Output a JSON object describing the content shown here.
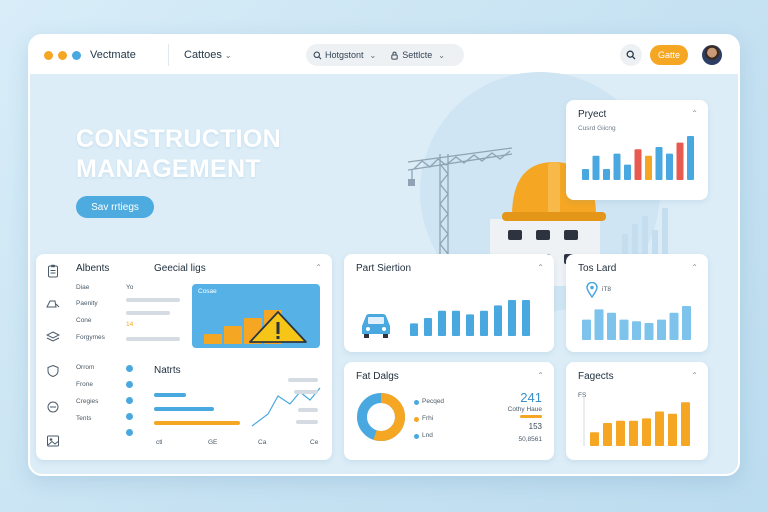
{
  "topbar": {
    "app_title": "Vectmate",
    "menu_label": "Cattoes",
    "pill_1": "Hotgstont",
    "pill_2": "Settlcte",
    "cta_label": "Gatte"
  },
  "hero": {
    "title_line1": "CONSTRUCTION",
    "title_line2": "MANAGEMENT",
    "button_label": "Sav rrtiegs"
  },
  "project_card": {
    "title": "Pryect",
    "subtitle": "Cusrd Giicng",
    "bars": [
      0.25,
      0.55,
      0.25,
      0.6,
      0.35,
      0.7,
      0.55,
      0.75,
      0.6,
      0.85,
      1.0
    ],
    "bar_colors": [
      "#4aa8e0",
      "#4aa8e0",
      "#4aa8e0",
      "#4aa8e0",
      "#4aa8e0",
      "#e85a4f",
      "#f5a623",
      "#4aa8e0",
      "#4aa8e0",
      "#e85a4f",
      "#4aa8e0"
    ]
  },
  "left_card": {
    "title_a": "Albents",
    "title_b": "Geecial ligs",
    "rows": [
      {
        "label": "Diae",
        "value": "Yo"
      },
      {
        "label": "Paenity",
        "value": ""
      },
      {
        "label": "Cone",
        "value": "14"
      },
      {
        "label": "Forgymes",
        "value": ""
      }
    ],
    "alert_title": "Cosae",
    "bars": [
      0.25,
      0.45,
      0.65,
      0.85
    ],
    "section2_title": "Natrts",
    "list2": [
      {
        "label": "Orrom"
      },
      {
        "label": "Frone"
      },
      {
        "label": "Cregies"
      },
      {
        "label": "Tents"
      }
    ],
    "axis_labels": [
      "ctl",
      "GE",
      "Ca",
      "Ce"
    ]
  },
  "part_card": {
    "title": "Part Siertion",
    "bars": [
      0.35,
      0.5,
      0.7,
      0.7,
      0.6,
      0.7,
      0.85,
      1.0,
      1.3
    ]
  },
  "total_card": {
    "title": "Tos Lard",
    "marker_label": "iT8",
    "bars": [
      0.6,
      0.9,
      0.8,
      0.6,
      0.55,
      0.5,
      0.6,
      0.8,
      1.1
    ]
  },
  "fat_card": {
    "title": "Fat Dalgs",
    "legend": [
      {
        "label": "Pecqed",
        "color": "#4aa8e0"
      },
      {
        "label": "Frhi",
        "color": "#f5a623"
      },
      {
        "label": "Lnd",
        "color": "#4aa8e0"
      }
    ],
    "big_value": "241",
    "caption": "Cothy Haue",
    "value_2": "153",
    "value_3": "50,8561",
    "donut": [
      0.55,
      0.45
    ]
  },
  "fagects_card": {
    "title": "Fagects",
    "axis_label": "FS",
    "bars": [
      0.3,
      0.5,
      0.55,
      0.55,
      0.6,
      0.75,
      0.7,
      0.95
    ]
  },
  "colors": {
    "accent_orange": "#f5a623",
    "accent_blue": "#4aa8e0",
    "alert_red": "#e85a4f"
  }
}
